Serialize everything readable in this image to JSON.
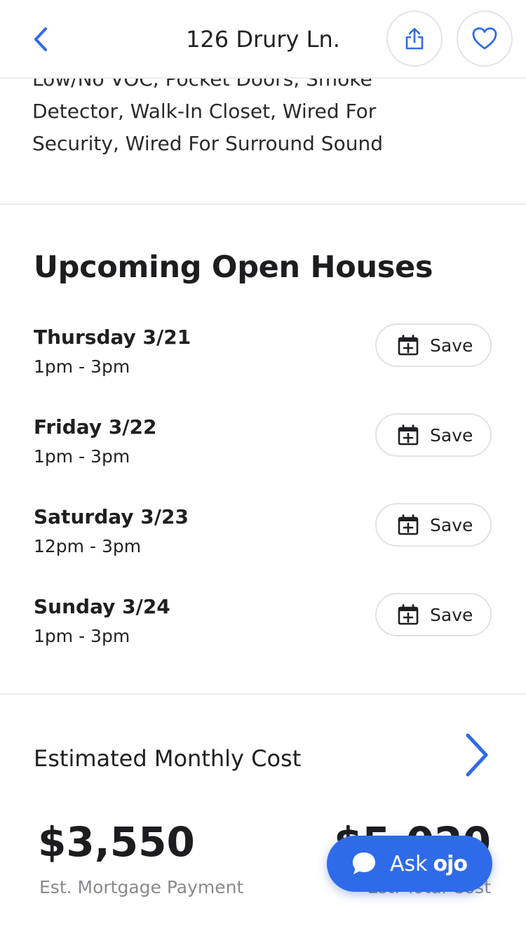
{
  "header": {
    "title": "126 Drury Ln.",
    "back_icon": "chevron-left-icon",
    "share_icon": "share-icon",
    "favorite_icon": "heart-icon"
  },
  "amenities": {
    "lines": [
      "Low/No VOC, Pocket Doors, Smoke",
      "Detector, Walk-In Closet, Wired For",
      "Security, Wired For Surround Sound"
    ]
  },
  "open_houses": {
    "title": "Upcoming Open Houses",
    "save_label": "Save",
    "items": [
      {
        "day": "Thursday 3/21",
        "time": "1pm - 3pm"
      },
      {
        "day": "Friday 3/22",
        "time": "1pm - 3pm"
      },
      {
        "day": "Saturday 3/23",
        "time": "12pm - 3pm"
      },
      {
        "day": "Sunday 3/24",
        "time": "1pm - 3pm"
      }
    ]
  },
  "monthly_cost": {
    "title": "Estimated Monthly Cost",
    "mortgage_value": "$3,550",
    "mortgage_label": "Est. Mortgage Payment",
    "total_value": "$5,020",
    "total_label": "Est. Total Cost"
  },
  "ask": {
    "label": "Ask",
    "brand": "ojo"
  },
  "colors": {
    "accent": "#2f6be8",
    "text": "#1f1f22",
    "muted": "#8a8a8e",
    "divider": "#ececec"
  }
}
